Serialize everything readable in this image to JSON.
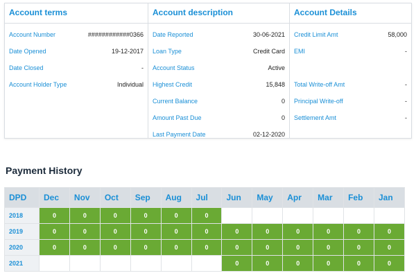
{
  "account_terms": {
    "title": "Account terms",
    "rows": [
      {
        "label": "Account Number",
        "value": "############0366"
      },
      {
        "label": "Date Opened",
        "value": "19-12-2017"
      },
      {
        "label": "Date Closed",
        "value": "-"
      },
      {
        "label": "Account Holder Type",
        "value": "Individual"
      }
    ]
  },
  "account_description": {
    "title": "Account description",
    "rows": [
      {
        "label": "Date Reported",
        "value": "30-06-2021"
      },
      {
        "label": "Loan Type",
        "value": "Credit Card"
      },
      {
        "label": "Account Status",
        "value": "Active"
      },
      {
        "label": "Highest Credit",
        "value": "15,848"
      },
      {
        "label": "Current Balance",
        "value": "0"
      },
      {
        "label": "Amount Past Due",
        "value": "0"
      },
      {
        "label": "Last Payment Date",
        "value": "02-12-2020"
      }
    ]
  },
  "account_details": {
    "title": "Account Details",
    "rows": [
      {
        "label": "Credit Limit Amt",
        "value": "58,000"
      },
      {
        "label": "EMI",
        "value": "-"
      },
      {
        "label": "",
        "value": ""
      },
      {
        "label": "Total Write-off Amt",
        "value": "-"
      },
      {
        "label": "Principal Write-off",
        "value": "-"
      },
      {
        "label": "Settlement Amt",
        "value": "-"
      }
    ]
  },
  "payment_history": {
    "title": "Payment History",
    "header_label": "DPD",
    "months": [
      "Dec",
      "Nov",
      "Oct",
      "Sep",
      "Aug",
      "Jul",
      "Jun",
      "May",
      "Apr",
      "Mar",
      "Feb",
      "Jan"
    ],
    "rows": [
      {
        "year": "2018",
        "cells": [
          "0",
          "0",
          "0",
          "0",
          "0",
          "0",
          "",
          "",
          "",
          "",
          "",
          ""
        ]
      },
      {
        "year": "2019",
        "cells": [
          "0",
          "0",
          "0",
          "0",
          "0",
          "0",
          "0",
          "0",
          "0",
          "0",
          "0",
          "0"
        ]
      },
      {
        "year": "2020",
        "cells": [
          "0",
          "0",
          "0",
          "0",
          "0",
          "0",
          "0",
          "0",
          "0",
          "0",
          "0",
          "0"
        ]
      },
      {
        "year": "2021",
        "cells": [
          "",
          "",
          "",
          "",
          "",
          "",
          "0",
          "0",
          "0",
          "0",
          "0",
          "0"
        ]
      }
    ],
    "good_color": "#6aaa34",
    "header_color": "#1a8fd6"
  }
}
